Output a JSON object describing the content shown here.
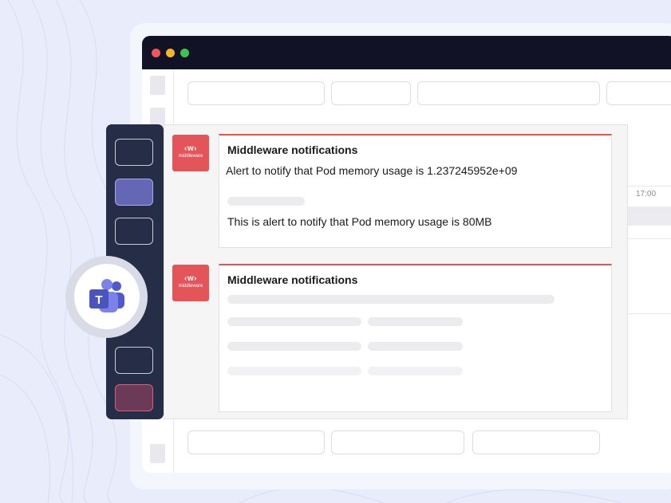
{
  "notifications": [
    {
      "logo_mark": "‹w›",
      "logo_word": "middleware",
      "title": "Middleware notifications",
      "messages": [
        "Alert to notify that Pod memory usage is 1.237245952e+09",
        "This is alert to notify that Pod memory usage is 80MB"
      ]
    },
    {
      "logo_mark": "‹w›",
      "logo_word": "middleware",
      "title": "Middleware notifications"
    }
  ],
  "timeline": {
    "time_label": "17:00"
  },
  "icons": [
    "teams-icon",
    "middleware-logo-icon"
  ],
  "colors": {
    "accent": "#e4555a",
    "sidebar": "#262d46",
    "titlebar": "#121226",
    "active": "#6468b4",
    "alert": "#e05a7c"
  }
}
